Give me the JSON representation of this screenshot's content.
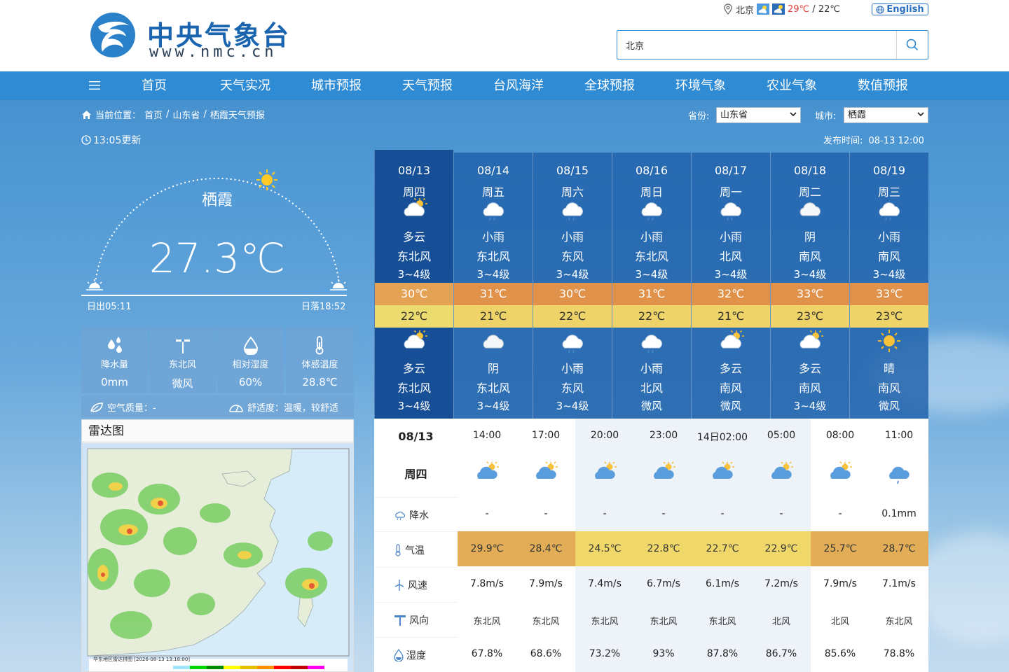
{
  "header": {
    "logo_title": "中央气象台",
    "logo_url": "www.nmc.cn",
    "location": "北京",
    "temp_high": "29℃",
    "temp_sep": " / ",
    "temp_low": "22℃",
    "lang_label": "English",
    "search_value": "北京"
  },
  "nav": {
    "items": [
      "首页",
      "天气实况",
      "城市预报",
      "天气预报",
      "台风海洋",
      "全球预报",
      "环境气象",
      "农业气象",
      "数值预报"
    ]
  },
  "breadcrumb": {
    "prefix": "当前位置：",
    "items": [
      "首页",
      "山东省",
      "栖霞天气预报"
    ],
    "sep": "/"
  },
  "selectors": {
    "province_label": "省份:",
    "province_value": "山东省",
    "city_label": "城市:",
    "city_value": "栖霞"
  },
  "update": {
    "time_text": "13:05更新",
    "publish_label": "发布时间:",
    "publish_time": "08-13 12:00"
  },
  "current": {
    "city": "栖霞",
    "temp": "27.3℃",
    "sunrise": "日出05:11",
    "sunset": "日落18:52",
    "stats": [
      {
        "icon": "rain-drops-icon",
        "label": "降水量",
        "value": "0mm"
      },
      {
        "icon": "wind-turbine-icon",
        "label": "东北风",
        "value": "微风"
      },
      {
        "icon": "humidity-drop-icon",
        "label": "相对湿度",
        "value": "60%"
      },
      {
        "icon": "thermometer-icon",
        "label": "体感温度",
        "value": "28.8℃"
      }
    ],
    "air_quality": "空气质量：-",
    "comfort": "舒适度：温暖，较舒适"
  },
  "radar": {
    "title": "雷达图",
    "caption": "华东地区雷达拼图 [2026-08-13 13:18:00]"
  },
  "daily": [
    {
      "date": "08/13",
      "week": "周四",
      "day_icon": "partly-cloudy-icon",
      "day_weather": "多云",
      "day_wind_dir": "东北风",
      "day_wind_level": "3~4级",
      "high": "30℃",
      "low": "22℃",
      "night_icon": "partly-cloudy-icon",
      "night_weather": "多云",
      "night_wind_dir": "东北风",
      "night_wind_level": "3~4级"
    },
    {
      "date": "08/14",
      "week": "周五",
      "day_icon": "light-rain-icon",
      "day_weather": "小雨",
      "day_wind_dir": "东北风",
      "day_wind_level": "3~4级",
      "high": "31℃",
      "low": "21℃",
      "night_icon": "overcast-icon",
      "night_weather": "阴",
      "night_wind_dir": "东北风",
      "night_wind_level": "3~4级"
    },
    {
      "date": "08/15",
      "week": "周六",
      "day_icon": "light-rain-icon",
      "day_weather": "小雨",
      "day_wind_dir": "东风",
      "day_wind_level": "3~4级",
      "high": "30℃",
      "low": "22℃",
      "night_icon": "light-rain-icon",
      "night_weather": "小雨",
      "night_wind_dir": "东风",
      "night_wind_level": "3~4级"
    },
    {
      "date": "08/16",
      "week": "周日",
      "day_icon": "light-rain-icon",
      "day_weather": "小雨",
      "day_wind_dir": "东北风",
      "day_wind_level": "3~4级",
      "high": "31℃",
      "low": "22℃",
      "night_icon": "light-rain-icon",
      "night_weather": "小雨",
      "night_wind_dir": "北风",
      "night_wind_level": "微风"
    },
    {
      "date": "08/17",
      "week": "周一",
      "day_icon": "light-rain-icon",
      "day_weather": "小雨",
      "day_wind_dir": "北风",
      "day_wind_level": "3~4级",
      "high": "32℃",
      "low": "21℃",
      "night_icon": "partly-cloudy-icon",
      "night_weather": "多云",
      "night_wind_dir": "南风",
      "night_wind_level": "微风"
    },
    {
      "date": "08/18",
      "week": "周二",
      "day_icon": "overcast-icon",
      "day_weather": "阴",
      "day_wind_dir": "南风",
      "day_wind_level": "3~4级",
      "high": "33℃",
      "low": "23℃",
      "night_icon": "partly-cloudy-icon",
      "night_weather": "多云",
      "night_wind_dir": "南风",
      "night_wind_level": "3~4级"
    },
    {
      "date": "08/19",
      "week": "周三",
      "day_icon": "light-rain-icon",
      "day_weather": "小雨",
      "day_wind_dir": "南风",
      "day_wind_level": "3~4级",
      "high": "33℃",
      "low": "23℃",
      "night_icon": "sunny-icon",
      "night_weather": "晴",
      "night_wind_dir": "南风",
      "night_wind_level": "微风"
    }
  ],
  "hourly": {
    "day": "08/13",
    "week": "周四",
    "row_labels": {
      "precip": "降水",
      "temp": "气温",
      "wind_speed": "风速",
      "wind_dir": "风向",
      "humidity": "湿度"
    },
    "items": [
      {
        "time": "14:00",
        "icon": "partly-cloudy-icon",
        "precip": "-",
        "temp": "29.9℃",
        "wind_speed": "7.8m/s",
        "wind_dir": "东北风",
        "humidity": "67.8%",
        "temp_color": "#e3ad57",
        "bg": "#ffffff"
      },
      {
        "time": "17:00",
        "icon": "partly-cloudy-icon",
        "precip": "-",
        "temp": "28.4℃",
        "wind_speed": "7.9m/s",
        "wind_dir": "东北风",
        "humidity": "68.6%",
        "temp_color": "#e3ad57",
        "bg": "#ffffff"
      },
      {
        "time": "20:00",
        "icon": "partly-cloudy-icon",
        "precip": "-",
        "temp": "24.5℃",
        "wind_speed": "7.4m/s",
        "wind_dir": "东北风",
        "humidity": "73.2%",
        "temp_color": "#efd769",
        "bg": "#eef3fa"
      },
      {
        "time": "23:00",
        "icon": "partly-cloudy-icon",
        "precip": "-",
        "temp": "22.8℃",
        "wind_speed": "6.7m/s",
        "wind_dir": "东北风",
        "humidity": "93%",
        "temp_color": "#efd769",
        "bg": "#eef3fa"
      },
      {
        "time": "14日02:00",
        "icon": "partly-cloudy-icon",
        "precip": "-",
        "temp": "22.7℃",
        "wind_speed": "6.1m/s",
        "wind_dir": "东北风",
        "humidity": "87.8%",
        "temp_color": "#efd769",
        "bg": "#eef3fa"
      },
      {
        "time": "05:00",
        "icon": "partly-cloudy-icon",
        "precip": "-",
        "temp": "22.9℃",
        "wind_speed": "7.2m/s",
        "wind_dir": "北风",
        "humidity": "86.7%",
        "temp_color": "#efd769",
        "bg": "#eef3fa"
      },
      {
        "time": "08:00",
        "icon": "partly-cloudy-icon",
        "precip": "-",
        "temp": "25.7℃",
        "wind_speed": "7.9m/s",
        "wind_dir": "北风",
        "humidity": "85.6%",
        "temp_color": "#e3ad57",
        "bg": "#ffffff"
      },
      {
        "time": "11:00",
        "icon": "light-rain-icon",
        "precip": "0.1mm",
        "temp": "28.7℃",
        "wind_speed": "7.1m/s",
        "wind_dir": "东北风",
        "humidity": "78.8%",
        "temp_color": "#e3ad57",
        "bg": "#ffffff"
      }
    ]
  },
  "colors": {
    "nav_bg": "#2f8bd3",
    "brand_blue": "#1b65b0",
    "high_temp_band": "#e0914a",
    "low_temp_band": "#eed368",
    "selected_day": "#164f95"
  }
}
